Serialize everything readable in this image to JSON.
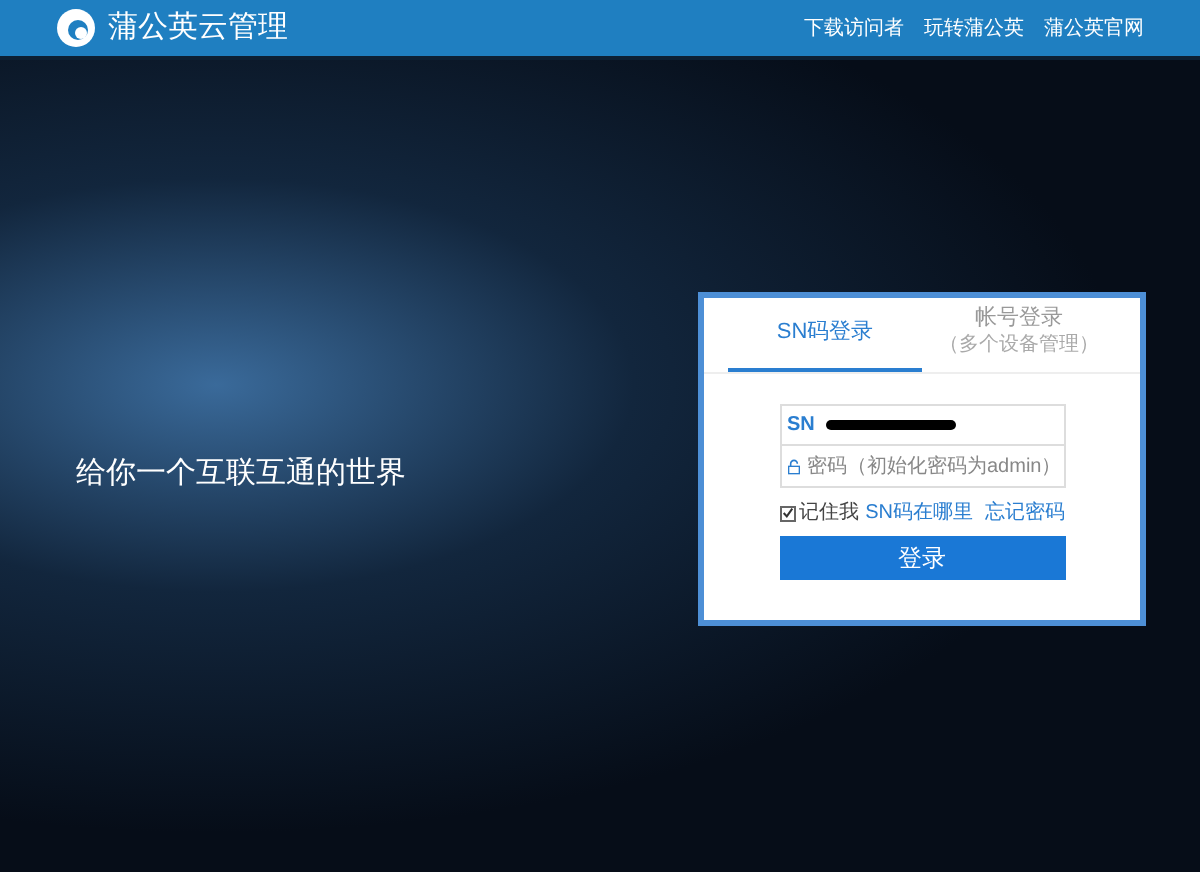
{
  "header": {
    "title": "蒲公英云管理",
    "nav": [
      "下载访问者",
      "玩转蒲公英",
      "蒲公英官网"
    ]
  },
  "hero": {
    "slogan": "给你一个互联互通的世界"
  },
  "login": {
    "tabs": [
      {
        "label": "SN码登录",
        "selected": true
      },
      {
        "label": "帐号登录",
        "sublabel": "（多个设备管理）",
        "selected": false
      }
    ],
    "sn": {
      "icon": "SN"
    },
    "password": {
      "placeholder": "密码（初始化密码为admin）"
    },
    "remember": {
      "label": "记住我",
      "checked": true
    },
    "links": [
      "SN码在哪里",
      "忘记密码"
    ],
    "submit": "登录"
  }
}
